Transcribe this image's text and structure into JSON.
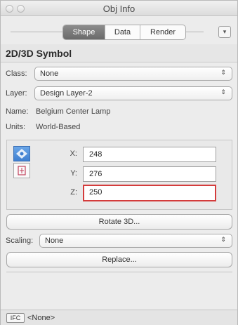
{
  "window": {
    "title": "Obj Info"
  },
  "tabs": [
    {
      "label": "Shape",
      "active": true
    },
    {
      "label": "Data",
      "active": false
    },
    {
      "label": "Render",
      "active": false
    }
  ],
  "header": {
    "title": "2D/3D Symbol"
  },
  "fields": {
    "class": {
      "label": "Class:",
      "value": "None"
    },
    "layer": {
      "label": "Layer:",
      "value": "Design Layer-2"
    }
  },
  "info": {
    "name_label": "Name:",
    "name_value": "Belgium Center Lamp",
    "units_label": "Units:",
    "units_value": "World-Based"
  },
  "coords": {
    "x_label": "X:",
    "x_value": "248",
    "y_label": "Y:",
    "y_value": "276",
    "z_label": "Z:",
    "z_value": "250"
  },
  "buttons": {
    "rotate": "Rotate 3D...",
    "replace": "Replace..."
  },
  "scaling": {
    "label": "Scaling:",
    "value": "None"
  },
  "footer": {
    "ifc_label": "IFC",
    "status": "<None>"
  },
  "colors": {
    "focus_border": "#d43c3c",
    "active_tab": "#7a7a7a"
  },
  "icons": [
    "window-close-icon",
    "window-minimize-icon",
    "palette-menu-icon",
    "popup-arrows-icon",
    "3d-locus-icon",
    "2d-locus-icon"
  ]
}
